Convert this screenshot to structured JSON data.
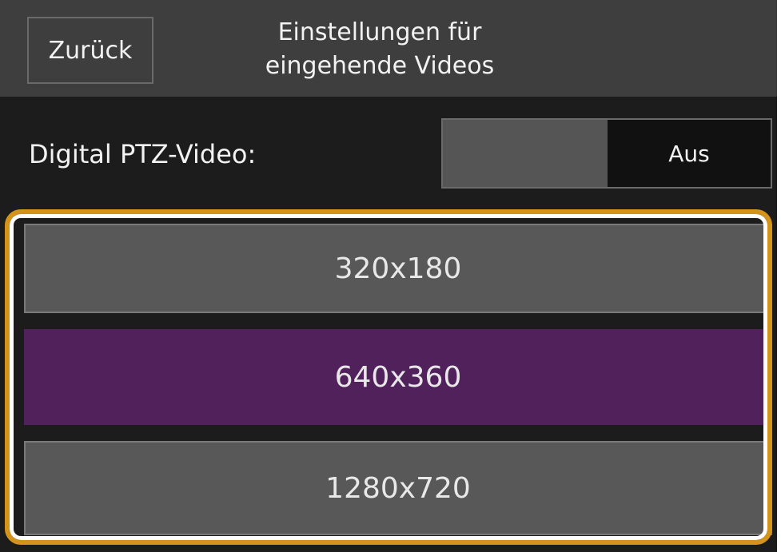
{
  "header": {
    "back_label": "Zurück",
    "title_line1": "Einstellungen für",
    "title_line2": "eingehende Videos"
  },
  "ptz": {
    "label": "Digital PTZ-Video:",
    "state": "Aus"
  },
  "resolutions": {
    "options": [
      {
        "label": "320x180",
        "selected": false
      },
      {
        "label": "640x360",
        "selected": true
      },
      {
        "label": "1280x720",
        "selected": false
      }
    ]
  },
  "colors": {
    "background": "#1c1c1c",
    "header": "#3e3e3e",
    "option": "#585858",
    "selected": "#51215c",
    "highlight": "#d4931b"
  }
}
